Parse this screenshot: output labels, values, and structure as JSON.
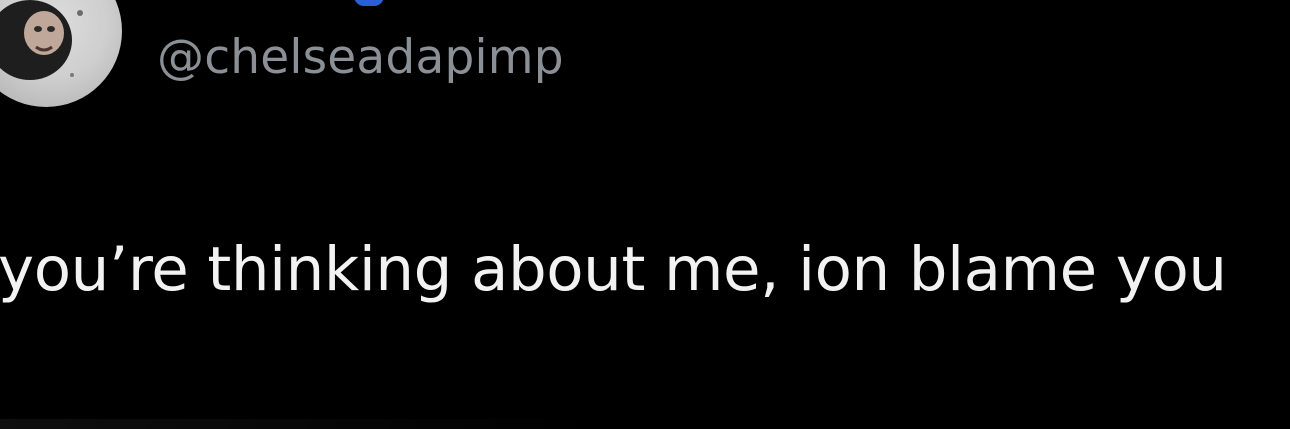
{
  "tweet": {
    "handle": "@chelseadapimp",
    "text": "you’re thinking about me, ion blame you"
  },
  "colors": {
    "background": "#000000",
    "text": "#f2f2f2",
    "handle": "#8b9097",
    "verified_accent": "#2b5fd9"
  },
  "icons": {
    "avatar": "profile-photo"
  }
}
